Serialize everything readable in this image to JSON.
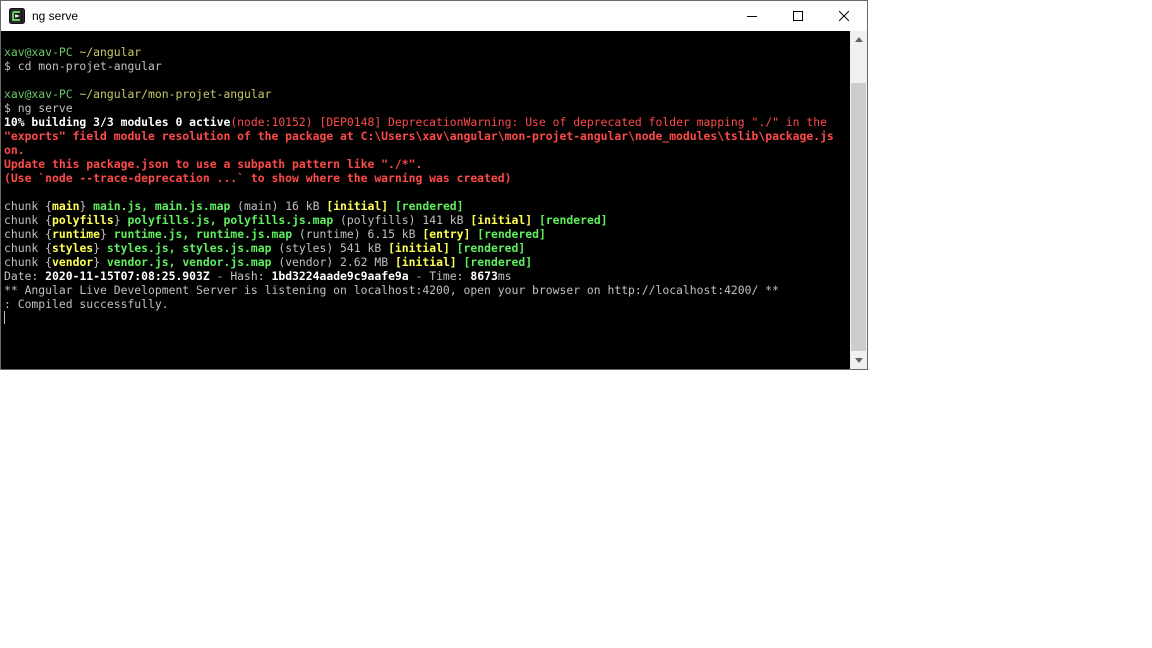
{
  "window": {
    "title": "ng serve",
    "app_icon": "terminal-app-icon",
    "controls": {
      "minimize": "minimize-icon",
      "maximize": "maximize-icon",
      "close": "close-icon"
    }
  },
  "terminal": {
    "lines": [
      [
        {
          "t": "xav@xav-PC ",
          "c": "green"
        },
        {
          "t": "~/angular",
          "c": "yellow"
        }
      ],
      [
        {
          "t": "$ cd mon-projet-angular",
          "c": "gray"
        }
      ],
      [
        {
          "t": "",
          "c": "gray"
        }
      ],
      [
        {
          "t": "xav@xav-PC ",
          "c": "green"
        },
        {
          "t": "~/angular/mon-projet-angular",
          "c": "yellow"
        }
      ],
      [
        {
          "t": "$ ng serve",
          "c": "gray"
        }
      ],
      [
        {
          "t": "10% building 3/3 modules 0 active",
          "c": "white-b"
        },
        {
          "t": "(node:10152) [DEP0148] DeprecationWarning: Use of deprecated folder mapping \"./\" in the",
          "c": "red"
        }
      ],
      [
        {
          "t": "\"exports\" field module resolution of the package at C:\\Users\\xav\\angular\\mon-projet-angular\\node_modules\\tslib\\package.js",
          "c": "red-b"
        }
      ],
      [
        {
          "t": "on.",
          "c": "red-b"
        }
      ],
      [
        {
          "t": "Update this package.json to use a subpath pattern like \"./*\".",
          "c": "red-b"
        }
      ],
      [
        {
          "t": "(Use `node --trace-deprecation ...` to show where the warning was created)",
          "c": "red-b"
        }
      ],
      [
        {
          "t": "",
          "c": "gray"
        }
      ],
      [
        {
          "t": "chunk {",
          "c": "gray"
        },
        {
          "t": "main",
          "c": "yellow-b"
        },
        {
          "t": "} ",
          "c": "gray"
        },
        {
          "t": "main.js, main.js.map",
          "c": "green-b"
        },
        {
          "t": " (main) 16 kB ",
          "c": "gray"
        },
        {
          "t": "[initial]",
          "c": "yellow-b"
        },
        {
          "t": " ",
          "c": "gray"
        },
        {
          "t": "[rendered]",
          "c": "green-b"
        }
      ],
      [
        {
          "t": "chunk {",
          "c": "gray"
        },
        {
          "t": "polyfills",
          "c": "yellow-b"
        },
        {
          "t": "} ",
          "c": "gray"
        },
        {
          "t": "polyfills.js, polyfills.js.map",
          "c": "green-b"
        },
        {
          "t": " (polyfills) 141 kB ",
          "c": "gray"
        },
        {
          "t": "[initial]",
          "c": "yellow-b"
        },
        {
          "t": " ",
          "c": "gray"
        },
        {
          "t": "[rendered]",
          "c": "green-b"
        }
      ],
      [
        {
          "t": "chunk {",
          "c": "gray"
        },
        {
          "t": "runtime",
          "c": "yellow-b"
        },
        {
          "t": "} ",
          "c": "gray"
        },
        {
          "t": "runtime.js, runtime.js.map",
          "c": "green-b"
        },
        {
          "t": " (runtime) 6.15 kB ",
          "c": "gray"
        },
        {
          "t": "[entry]",
          "c": "yellow-b"
        },
        {
          "t": " ",
          "c": "gray"
        },
        {
          "t": "[rendered]",
          "c": "green-b"
        }
      ],
      [
        {
          "t": "chunk {",
          "c": "gray"
        },
        {
          "t": "styles",
          "c": "yellow-b"
        },
        {
          "t": "} ",
          "c": "gray"
        },
        {
          "t": "styles.js, styles.js.map",
          "c": "green-b"
        },
        {
          "t": " (styles) 541 kB ",
          "c": "gray"
        },
        {
          "t": "[initial]",
          "c": "yellow-b"
        },
        {
          "t": " ",
          "c": "gray"
        },
        {
          "t": "[rendered]",
          "c": "green-b"
        }
      ],
      [
        {
          "t": "chunk {",
          "c": "gray"
        },
        {
          "t": "vendor",
          "c": "yellow-b"
        },
        {
          "t": "} ",
          "c": "gray"
        },
        {
          "t": "vendor.js, vendor.js.map",
          "c": "green-b"
        },
        {
          "t": " (vendor) 2.62 MB ",
          "c": "gray"
        },
        {
          "t": "[initial]",
          "c": "yellow-b"
        },
        {
          "t": " ",
          "c": "gray"
        },
        {
          "t": "[rendered]",
          "c": "green-b"
        }
      ],
      [
        {
          "t": "Date: ",
          "c": "gray"
        },
        {
          "t": "2020-11-15T07:08:25.903Z",
          "c": "white-b"
        },
        {
          "t": " - Hash: ",
          "c": "gray"
        },
        {
          "t": "1bd3224aade9c9aafe9a",
          "c": "white-b"
        },
        {
          "t": " - Time: ",
          "c": "gray"
        },
        {
          "t": "8673",
          "c": "white-b"
        },
        {
          "t": "ms",
          "c": "gray"
        }
      ],
      [
        {
          "t": "** Angular Live Development Server is listening on localhost:4200, open your browser on http://localhost:4200/ **",
          "c": "gray"
        }
      ],
      [
        {
          "t": ": Compiled successfully.",
          "c": "gray"
        }
      ]
    ]
  },
  "colors": {
    "terminal_bg": "#000000",
    "prompt_user": "#6ac96a",
    "prompt_path": "#c8c86a",
    "error_red": "#ff4a4a",
    "success_green": "#5ff05f",
    "tag_yellow": "#ffff55"
  },
  "scrollbar": {
    "up": "scroll-up-arrow-icon",
    "down": "scroll-down-arrow-icon"
  }
}
